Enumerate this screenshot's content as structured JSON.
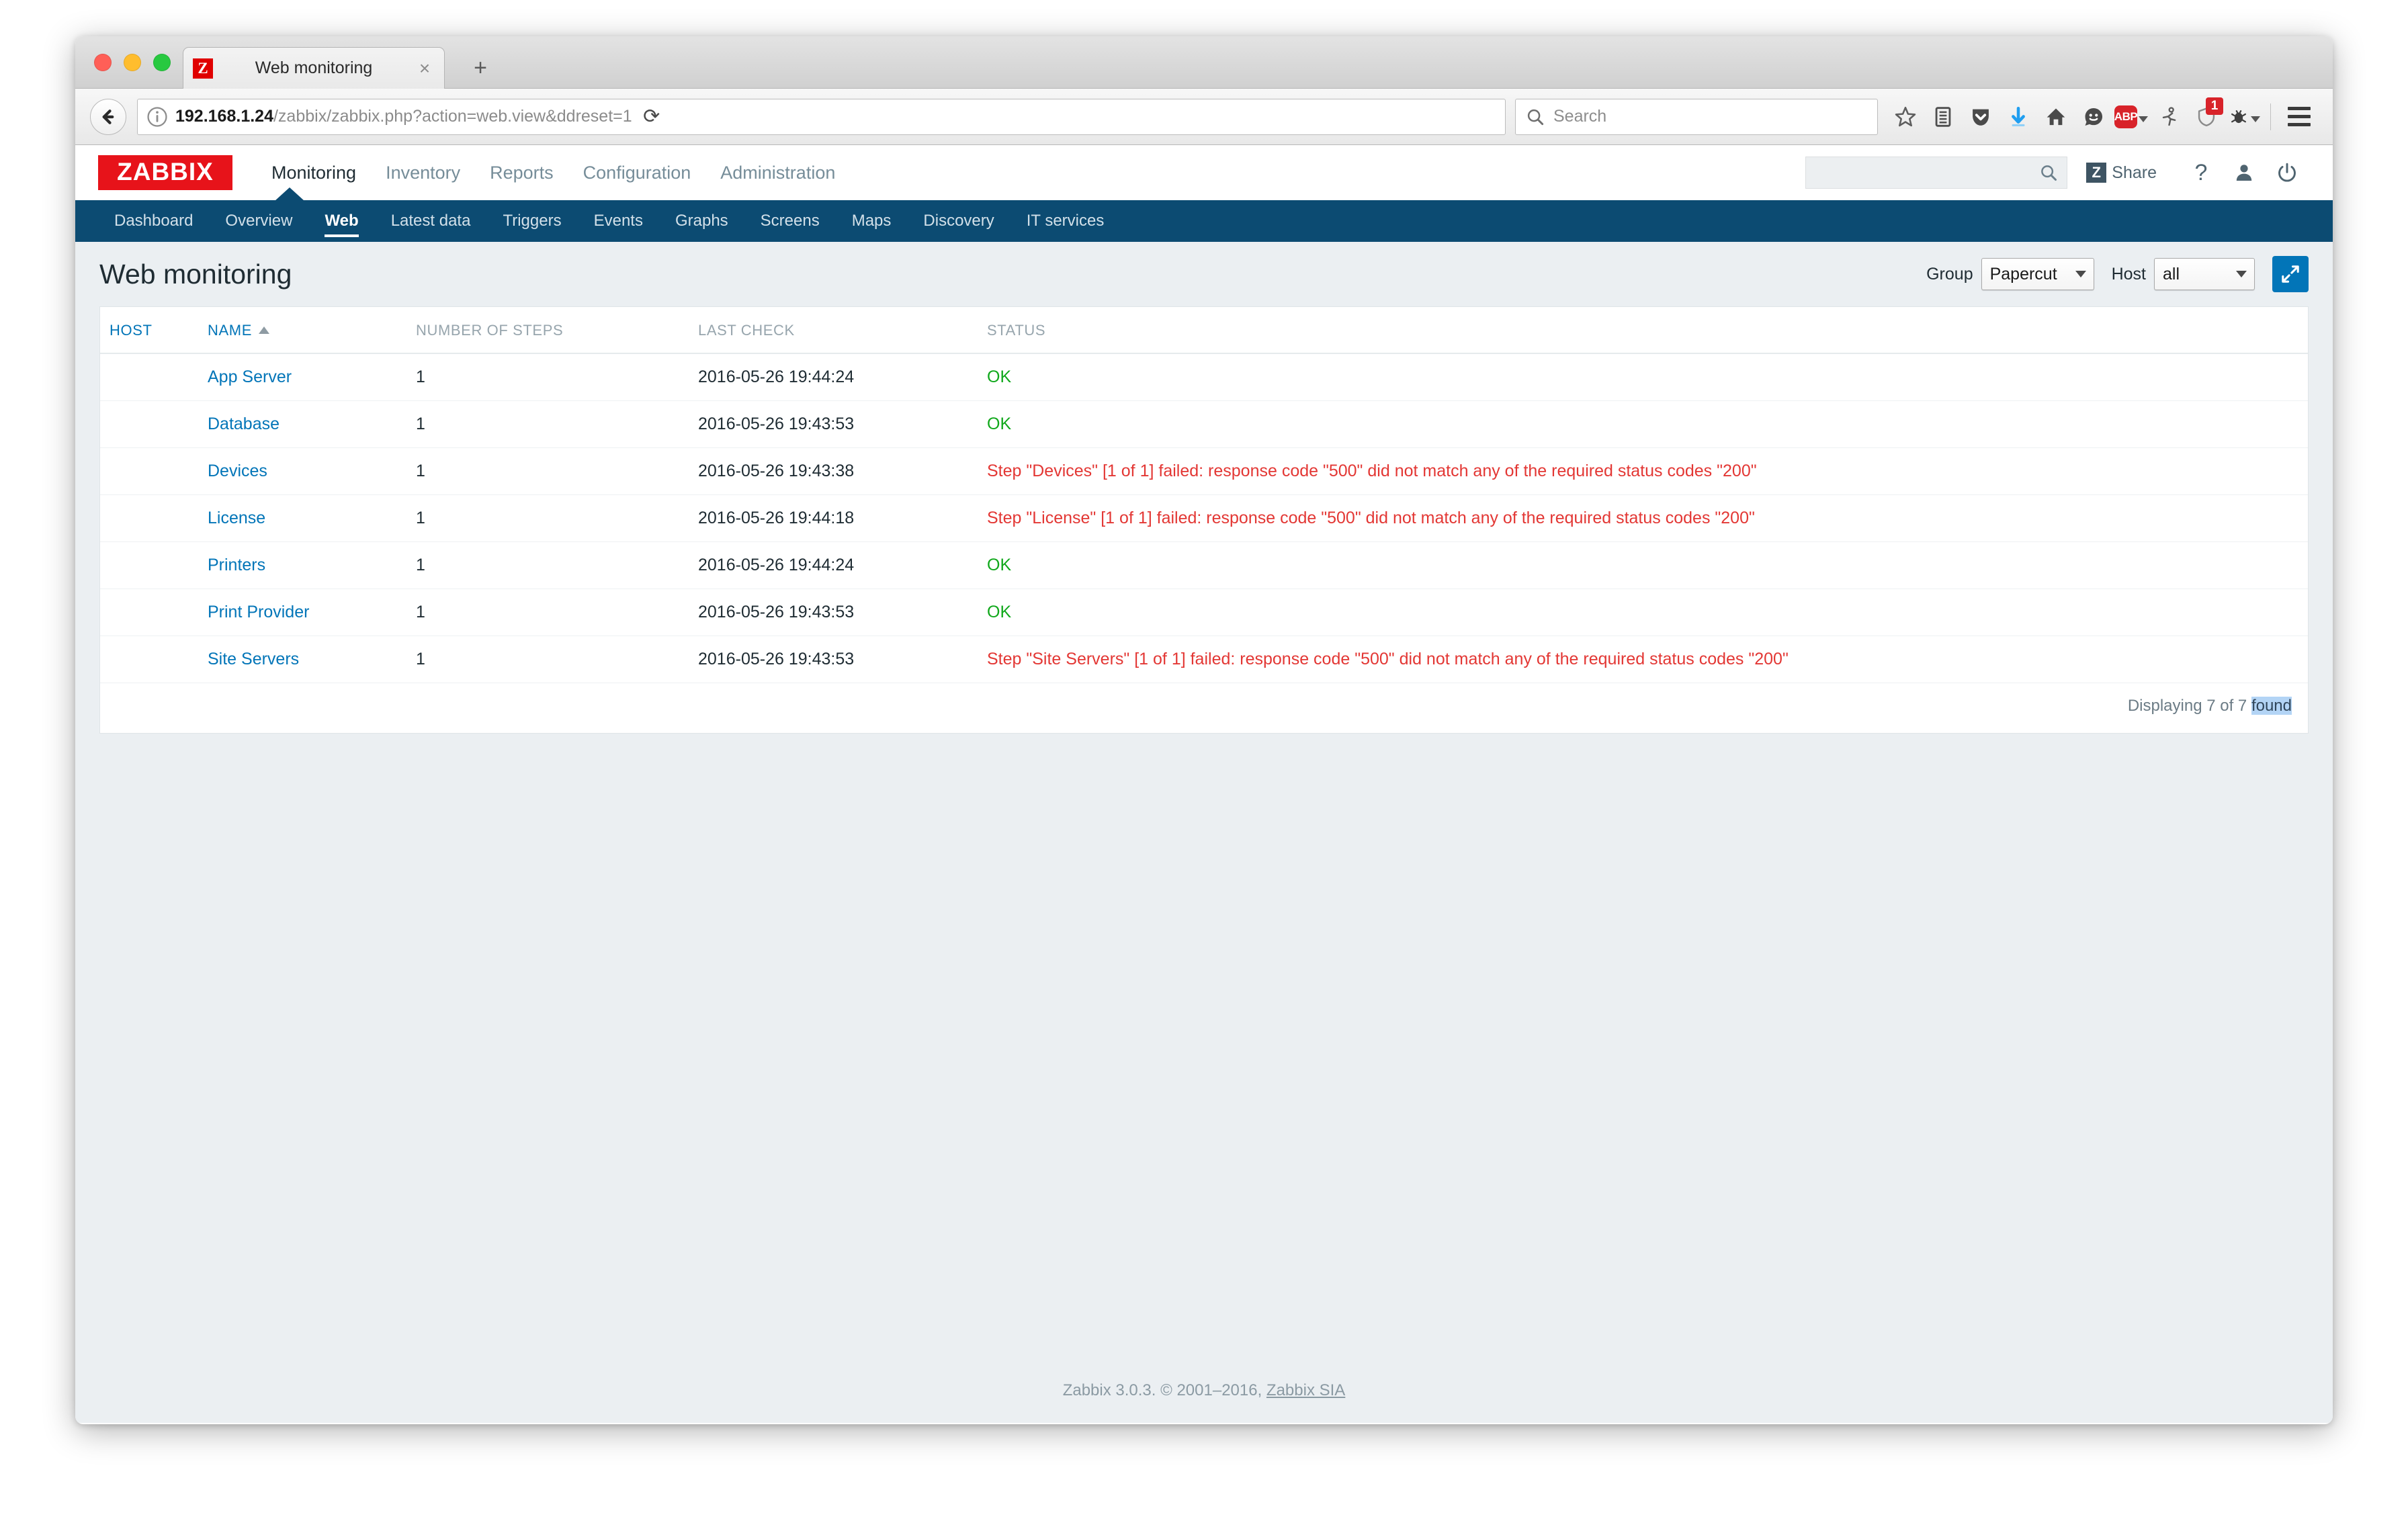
{
  "window": {
    "traffic_lights": [
      "close",
      "minimize",
      "zoom"
    ],
    "colors": {
      "close": "#ff5f57",
      "minimize": "#ffbd2e",
      "zoom": "#28c940",
      "zabbix_red": "#e7131a",
      "zabbix_blue": "#0275b8",
      "subnav_blue": "#0c4b72",
      "status_ok_green": "#10a81b",
      "status_error_red": "#e33734",
      "page_background": "#ebeff2"
    }
  },
  "browser": {
    "tab": {
      "favicon_letter": "Z",
      "title": "Web monitoring",
      "close_label": "×"
    },
    "new_tab_label": "+",
    "url": {
      "host": "192.168.1.24",
      "path": "/zabbix/zabbix.php?action=web.view&ddreset=1"
    },
    "reload_label": "⟳",
    "search": {
      "placeholder": "Search"
    },
    "extensions": {
      "abp_label": "ABP",
      "shield_badge_count": "1"
    }
  },
  "zabbix": {
    "logo": "ZABBIX",
    "main_menu": [
      {
        "label": "Monitoring",
        "active": true
      },
      {
        "label": "Inventory",
        "active": false
      },
      {
        "label": "Reports",
        "active": false
      },
      {
        "label": "Configuration",
        "active": false
      },
      {
        "label": "Administration",
        "active": false
      }
    ],
    "header_right": {
      "search_value": "",
      "share_badge": "Z",
      "share_label": "Share",
      "help_label": "?"
    },
    "sub_menu": [
      {
        "label": "Dashboard",
        "active": false
      },
      {
        "label": "Overview",
        "active": false
      },
      {
        "label": "Web",
        "active": true
      },
      {
        "label": "Latest data",
        "active": false
      },
      {
        "label": "Triggers",
        "active": false
      },
      {
        "label": "Events",
        "active": false
      },
      {
        "label": "Graphs",
        "active": false
      },
      {
        "label": "Screens",
        "active": false
      },
      {
        "label": "Maps",
        "active": false
      },
      {
        "label": "Discovery",
        "active": false
      },
      {
        "label": "IT services",
        "active": false
      }
    ],
    "page_title": "Web monitoring",
    "filters": {
      "group_label": "Group",
      "group_value": "Papercut",
      "host_label": "Host",
      "host_value": "all"
    },
    "table": {
      "columns": [
        {
          "key": "host",
          "label": "HOST",
          "sortable": true,
          "sorted": false
        },
        {
          "key": "name",
          "label": "NAME",
          "sortable": true,
          "sorted": true,
          "sort_direction": "asc"
        },
        {
          "key": "steps",
          "label": "NUMBER OF STEPS",
          "sortable": false
        },
        {
          "key": "last_check",
          "label": "LAST CHECK",
          "sortable": false
        },
        {
          "key": "status",
          "label": "STATUS",
          "sortable": false
        }
      ],
      "rows": [
        {
          "host": "",
          "name": "App Server",
          "steps": "1",
          "last_check": "2016-05-26 19:44:24",
          "status": "OK",
          "status_state": "ok"
        },
        {
          "host": "",
          "name": "Database",
          "steps": "1",
          "last_check": "2016-05-26 19:43:53",
          "status": "OK",
          "status_state": "ok"
        },
        {
          "host": "",
          "name": "Devices",
          "steps": "1",
          "last_check": "2016-05-26 19:43:38",
          "status": "Step \"Devices\" [1 of 1] failed: response code \"500\" did not match any of the required status codes \"200\"",
          "status_state": "error"
        },
        {
          "host": "",
          "name": "License",
          "steps": "1",
          "last_check": "2016-05-26 19:44:18",
          "status": "Step \"License\" [1 of 1] failed: response code \"500\" did not match any of the required status codes \"200\"",
          "status_state": "error"
        },
        {
          "host": "",
          "name": "Printers",
          "steps": "1",
          "last_check": "2016-05-26 19:44:24",
          "status": "OK",
          "status_state": "ok"
        },
        {
          "host": "",
          "name": "Print Provider",
          "steps": "1",
          "last_check": "2016-05-26 19:43:53",
          "status": "OK",
          "status_state": "ok"
        },
        {
          "host": "",
          "name": "Site Servers",
          "steps": "1",
          "last_check": "2016-05-26 19:43:53",
          "status": "Step \"Site Servers\" [1 of 1] failed: response code \"500\" did not match any of the required status codes \"200\"",
          "status_state": "error"
        }
      ],
      "displaying_prefix": "Displaying 7 of 7 ",
      "displaying_highlight": "found"
    },
    "footer": {
      "text": "Zabbix 3.0.3. © 2001–2016, ",
      "link": "Zabbix SIA"
    }
  }
}
